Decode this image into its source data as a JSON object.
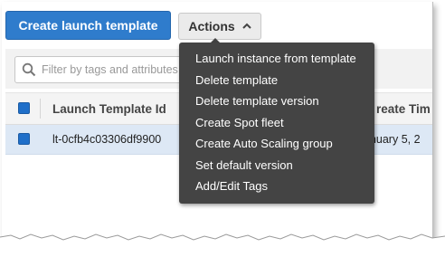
{
  "toolbar": {
    "create_label": "Create launch template",
    "actions_label": "Actions"
  },
  "search": {
    "placeholder": "Filter by tags and attributes"
  },
  "table": {
    "columns": [
      "Launch Template Id",
      "Create Time"
    ],
    "header_partial": "reate Tim",
    "rows": [
      {
        "id": "lt-0cfb4c03306df9900",
        "create_time_partial": "anuary 5, 2"
      }
    ]
  },
  "actions_menu": {
    "items": [
      {
        "label": "Launch instance from template"
      },
      {
        "label": "Delete template"
      },
      {
        "label": "Delete template version"
      },
      {
        "label": "Create Spot fleet"
      },
      {
        "label": "Create Auto Scaling group"
      },
      {
        "label": "Set default version"
      },
      {
        "label": "Add/Edit Tags"
      }
    ]
  },
  "colors": {
    "primary": "#2f7ccc",
    "menu_bg": "#444444",
    "selected_row": "#dde8f5"
  }
}
